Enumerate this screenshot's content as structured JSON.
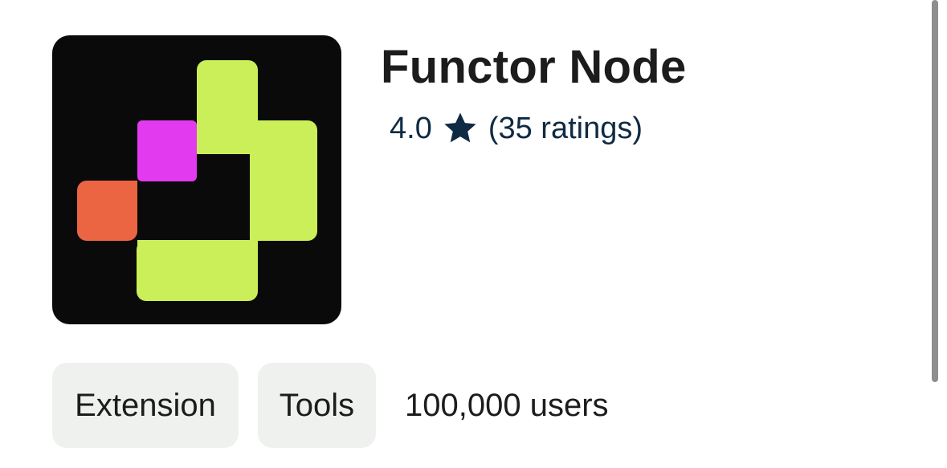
{
  "app": {
    "title": "Functor Node",
    "icon": "functor-node-logo",
    "colors": {
      "icon_background": "#0a0a0a",
      "lime": "#cbef58",
      "magenta": "#e23bef",
      "orange": "#ec6543"
    }
  },
  "rating": {
    "value": "4.0",
    "star_icon": "star-icon",
    "count": "(35 ratings)",
    "color": "#0f2a43"
  },
  "tags": {
    "type": "Extension",
    "category": "Tools"
  },
  "users": "100,000 users"
}
